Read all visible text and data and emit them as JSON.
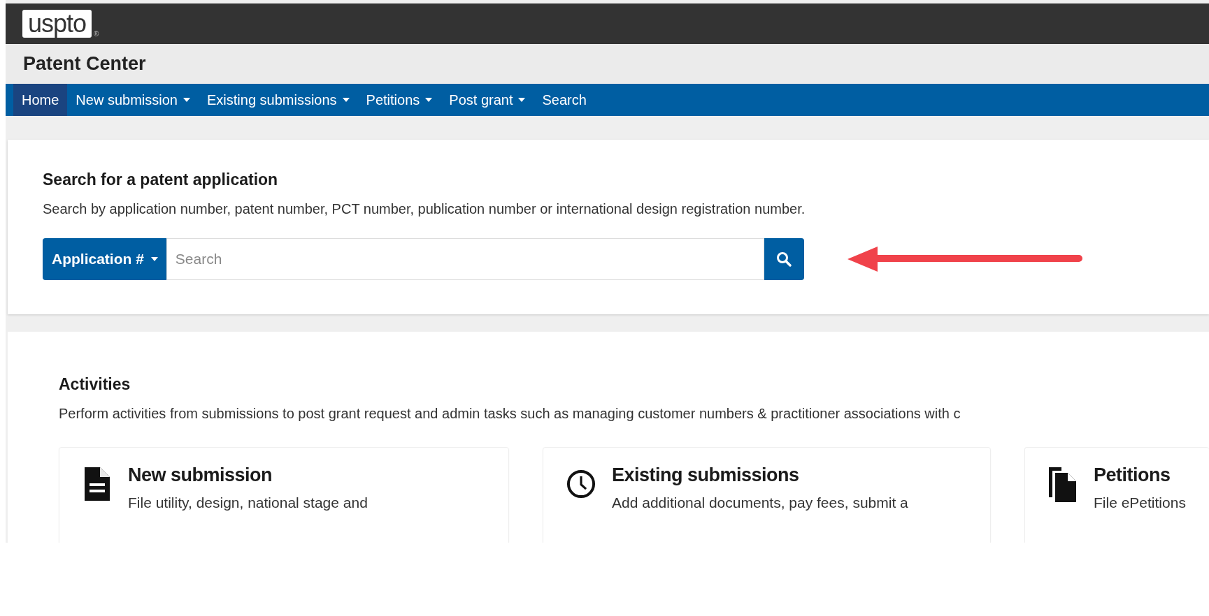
{
  "logo": {
    "text": "uspto",
    "mark": "®"
  },
  "app_title": "Patent Center",
  "nav": [
    {
      "label": "Home",
      "selected": true,
      "dropdown": false
    },
    {
      "label": "New submission",
      "selected": false,
      "dropdown": true
    },
    {
      "label": "Existing submissions",
      "selected": false,
      "dropdown": true
    },
    {
      "label": "Petitions",
      "selected": false,
      "dropdown": true
    },
    {
      "label": "Post grant",
      "selected": false,
      "dropdown": true
    },
    {
      "label": "Search",
      "selected": false,
      "dropdown": false
    }
  ],
  "search_panel": {
    "title": "Search for a patent application",
    "description": "Search by application number, patent number, PCT number, publication number or international design registration number.",
    "type_button": "Application #",
    "placeholder": "Search"
  },
  "activities": {
    "title": "Activities",
    "description": "Perform activities from submissions to post grant request and admin tasks such as managing customer numbers & practitioner associations with c",
    "cards": [
      {
        "kind": "document",
        "title": "New submission",
        "description": "File utility, design, national stage and"
      },
      {
        "kind": "clock",
        "title": "Existing submissions",
        "description": "Add additional documents, pay fees, submit a"
      },
      {
        "kind": "copies",
        "title": "Petitions",
        "description": "File ePetitions"
      }
    ]
  }
}
